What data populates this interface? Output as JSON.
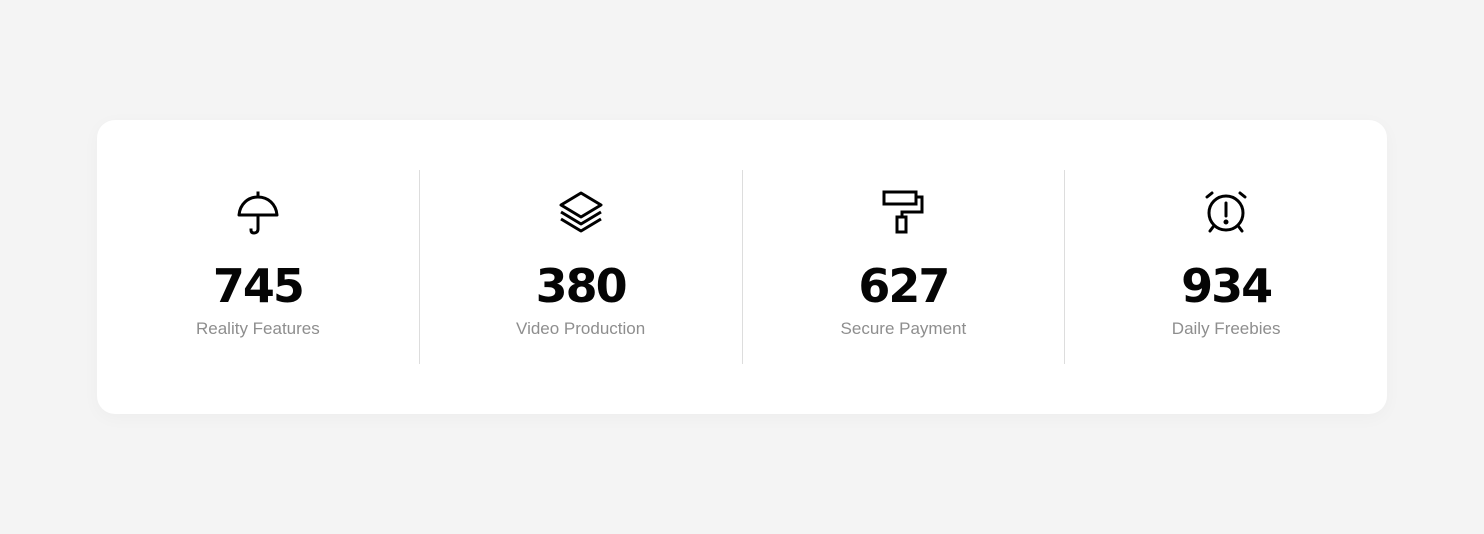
{
  "stats": [
    {
      "icon": "umbrella-icon",
      "value": "745",
      "label": "Reality Features"
    },
    {
      "icon": "layers-icon",
      "value": "380",
      "label": "Video Production"
    },
    {
      "icon": "paint-roller-icon",
      "value": "627",
      "label": "Secure Payment"
    },
    {
      "icon": "alarm-clock-icon",
      "value": "934",
      "label": "Daily Freebies"
    }
  ],
  "colors": {
    "background": "#f4f4f4",
    "card": "#ffffff",
    "value_text": "#050505",
    "label_text": "#8e8e8e",
    "divider": "#dddddd"
  }
}
